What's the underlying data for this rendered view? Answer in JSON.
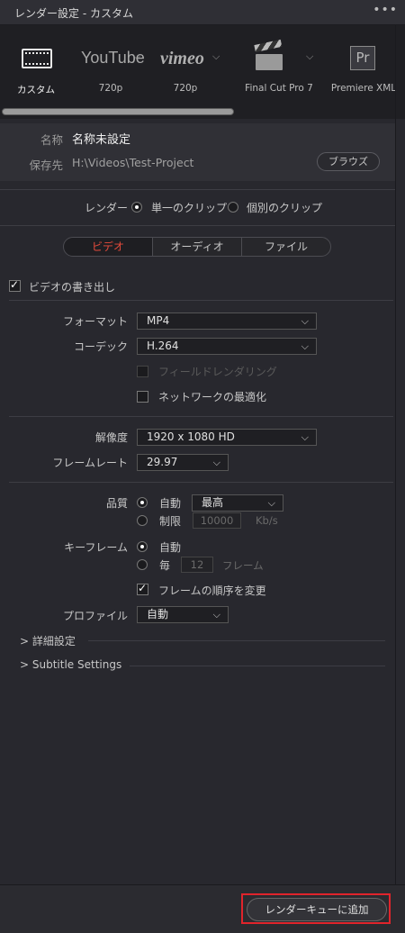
{
  "title": "レンダー設定 - カスタム",
  "more": "•••",
  "presets": [
    {
      "label": "カスタム"
    },
    {
      "label": "720p",
      "brand": "YouTube"
    },
    {
      "label": "720p",
      "brand": "vimeo"
    },
    {
      "label": "Final Cut Pro 7"
    },
    {
      "label": "Premiere XML",
      "brand": "Pr"
    }
  ],
  "name_label": "名称",
  "name_value": "名称未設定",
  "location_label": "保存先",
  "location_value": "H:\\Videos\\Test-Project",
  "browse": "ブラウズ",
  "render_label": "レンダー",
  "render_single": "単一のクリップ",
  "render_individual": "個別のクリップ",
  "tabs": [
    "ビデオ",
    "オーディオ",
    "ファイル"
  ],
  "export_video": "ビデオの書き出し",
  "format_label": "フォーマット",
  "format_value": "MP4",
  "codec_label": "コーデック",
  "codec_value": "H.264",
  "field_rendering": "フィールドレンダリング",
  "network_opt": "ネットワークの最適化",
  "resolution_label": "解像度",
  "resolution_value": "1920 x 1080 HD",
  "framerate_label": "フレームレート",
  "framerate_value": "29.97",
  "quality_label": "品質",
  "quality_auto": "自動",
  "quality_level": "最高",
  "quality_limit": "制限",
  "quality_limit_value": "10000",
  "quality_unit": "Kb/s",
  "keyframe_label": "キーフレーム",
  "keyframe_auto": "自動",
  "keyframe_every": "毎",
  "keyframe_value": "12",
  "keyframe_unit": "フレーム",
  "frame_reorder": "フレームの順序を変更",
  "profile_label": "プロファイル",
  "profile_value": "自動",
  "advanced": "詳細設定",
  "subtitle": "Subtitle Settings",
  "add_queue": "レンダーキューに追加",
  "colors": {
    "accent": "#e64b3c",
    "highlight_box": "#e0242b"
  }
}
